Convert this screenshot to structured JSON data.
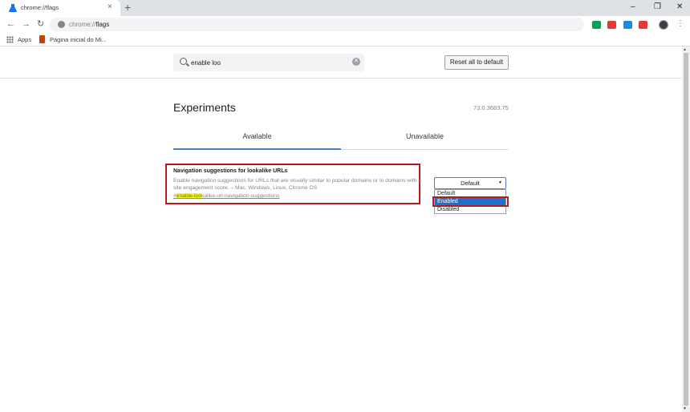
{
  "browser": {
    "tab_title": "chrome://flags",
    "tab_close": "×",
    "new_tab": "+",
    "window_controls": {
      "minimize": "–",
      "restore": "❐",
      "close": "✕"
    },
    "url_scheme": "chrome://",
    "url_path": "flags",
    "bookmarks": {
      "apps": "Apps",
      "item1": "Página inicial do Mi..."
    },
    "extensions": [
      {
        "name": "sheets-icon",
        "color": "#0f9d58"
      },
      {
        "name": "youtube-icon",
        "color": "#e53935"
      },
      {
        "name": "calendar-icon",
        "color": "#1e88e5"
      },
      {
        "name": "youtube-icon-2",
        "color": "#e53935"
      }
    ]
  },
  "flags": {
    "search_value": "enable loo",
    "reset_label": "Reset all to default",
    "title": "Experiments",
    "version": "73.0.3683.75",
    "tabs": [
      "Available",
      "Unavailable"
    ],
    "flag": {
      "name": "Navigation suggestions for lookalike URLs",
      "description": "Enable navigation suggestions for URLs that are visually similar to popular domains or to domains with a site engagement score. – Mac, Windows, Linux, Chrome OS",
      "link_prefix": "#",
      "link_highlight": "enable-loo",
      "link_rest": "kalike-url-navigation-suggestions"
    },
    "select": {
      "value": "Default",
      "options": [
        "Default",
        "Enabled",
        "Disabled"
      ]
    }
  }
}
